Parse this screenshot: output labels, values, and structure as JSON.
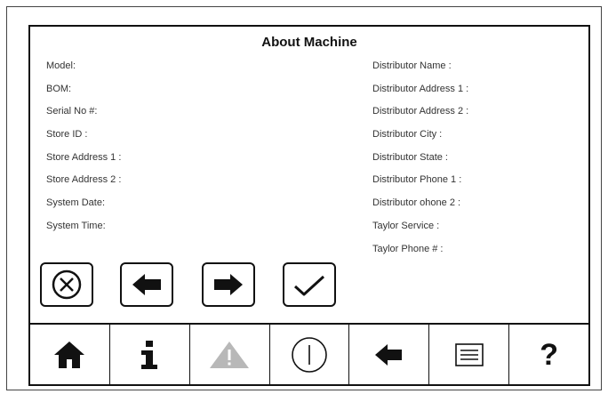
{
  "page": {
    "title": "About Machine"
  },
  "fields": {
    "left": [
      {
        "label": "Model:"
      },
      {
        "label": "BOM:"
      },
      {
        "label": "Serial No #:"
      },
      {
        "label": "Store ID :"
      },
      {
        "label": "Store Address 1 :"
      },
      {
        "label": "Store Address 2 :"
      },
      {
        "label": "System Date:"
      },
      {
        "label": "System Time:"
      }
    ],
    "right": [
      {
        "label": "Distributor Name :"
      },
      {
        "label": "Distributor Address 1 :"
      },
      {
        "label": "Distributor Address 2 :"
      },
      {
        "label": "Distributor City  :"
      },
      {
        "label": "Distributor State :"
      },
      {
        "label": "Distributor Phone 1 :"
      },
      {
        "label": "Distributor ohone 2 :"
      },
      {
        "label": "Taylor Service :"
      },
      {
        "label": "Taylor Phone # :"
      }
    ]
  },
  "action_buttons": [
    {
      "icon": "cancel-circle-x-icon"
    },
    {
      "icon": "arrow-left-icon"
    },
    {
      "icon": "arrow-right-icon"
    },
    {
      "icon": "checkmark-icon"
    }
  ],
  "nav_bar": [
    {
      "icon": "home-icon"
    },
    {
      "icon": "info-icon"
    },
    {
      "icon": "warning-icon",
      "color": "#b8b8b8"
    },
    {
      "icon": "power-icon"
    },
    {
      "icon": "back-arrow-icon"
    },
    {
      "icon": "menu-list-icon"
    },
    {
      "icon": "help-icon",
      "glyph": "?"
    }
  ],
  "colors": {
    "border": "#111111",
    "text": "#333333",
    "warning_disabled": "#b8b8b8"
  }
}
